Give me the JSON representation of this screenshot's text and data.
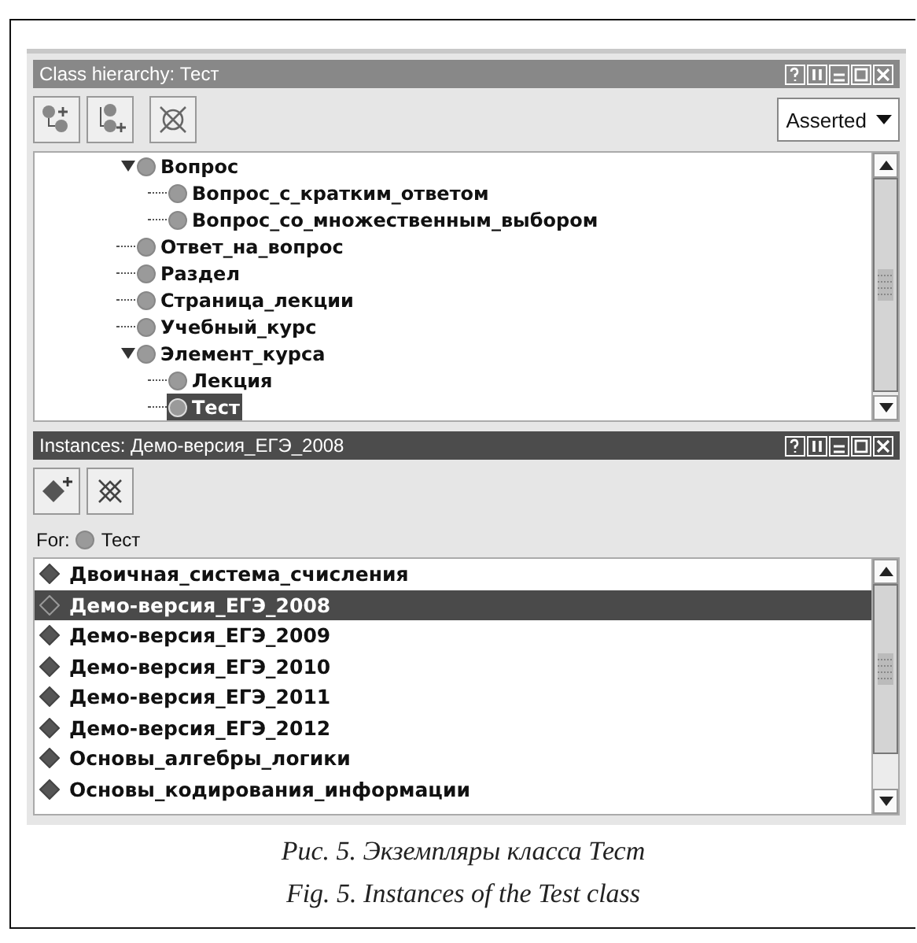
{
  "class_panel": {
    "title": "Class hierarchy: Тест",
    "view_select": {
      "value": "Asserted"
    },
    "tree": [
      {
        "label": "Вопрос",
        "expanded": true,
        "selected": false,
        "children": [
          {
            "label": "Вопрос_с_кратким_ответом",
            "selected": false
          },
          {
            "label": "Вопрос_со_множественным_выбором",
            "selected": false
          }
        ]
      },
      {
        "label": "Ответ_на_вопрос",
        "selected": false
      },
      {
        "label": "Раздел",
        "selected": false
      },
      {
        "label": "Страница_лекции",
        "selected": false
      },
      {
        "label": "Учебный_курс",
        "selected": false
      },
      {
        "label": "Элемент_курса",
        "expanded": true,
        "selected": false,
        "children": [
          {
            "label": "Лекция",
            "selected": false
          },
          {
            "label": "Тест",
            "selected": true
          }
        ]
      }
    ]
  },
  "instances_panel": {
    "title": "Instances: Демо-версия_ЕГЭ_2008",
    "for_label": "For:",
    "for_class": "Тест",
    "items": [
      {
        "label": "Двоичная_система_счисления",
        "selected": false
      },
      {
        "label": "Демо-версия_ЕГЭ_2008",
        "selected": true
      },
      {
        "label": "Демо-версия_ЕГЭ_2009",
        "selected": false
      },
      {
        "label": "Демо-версия_ЕГЭ_2010",
        "selected": false
      },
      {
        "label": "Демо-версия_ЕГЭ_2011",
        "selected": false
      },
      {
        "label": "Демо-версия_ЕГЭ_2012",
        "selected": false
      },
      {
        "label": "Основы_алгебры_логики",
        "selected": false
      },
      {
        "label": "Основы_кодирования_информации",
        "selected": false
      }
    ]
  },
  "captions": [
    "Рис. 5. Экземпляры класса Тест",
    "Fig. 5. Instances of the Test class"
  ]
}
